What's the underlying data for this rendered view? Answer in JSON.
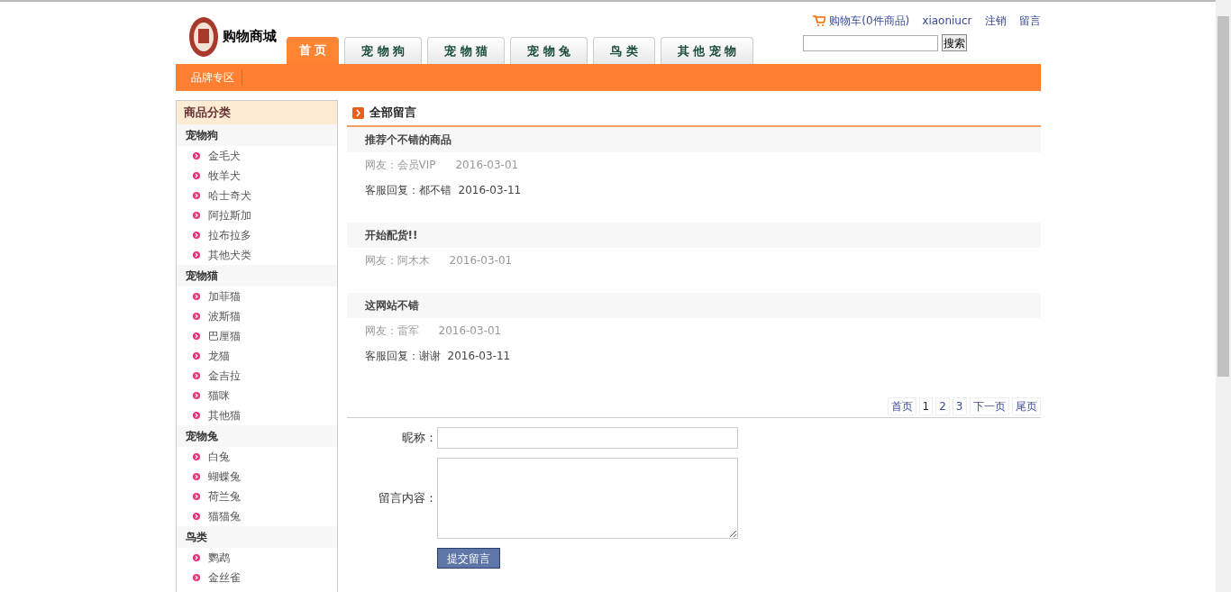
{
  "header": {
    "logo_text": "购物商城",
    "cart": "购物车(0件商品)",
    "links": [
      "xiaoniucr",
      "注销",
      "留言"
    ],
    "search_button": "搜索"
  },
  "nav_tabs": [
    {
      "label": "首 页",
      "selected": true
    },
    {
      "label": "宠 物 狗",
      "selected": false
    },
    {
      "label": "宠 物 猫",
      "selected": false
    },
    {
      "label": "宠 物 兔",
      "selected": false
    },
    {
      "label": "鸟 类",
      "selected": false
    },
    {
      "label": "其 他 宠 物",
      "selected": false
    }
  ],
  "sub_nav": [
    "品牌专区"
  ],
  "sidebar": {
    "title": "商品分类",
    "groups": [
      {
        "name": "宠物狗",
        "items": [
          "金毛犬",
          "牧羊犬",
          "哈士奇犬",
          "阿拉斯加",
          "拉布拉多",
          "其他犬类"
        ]
      },
      {
        "name": "宠物猫",
        "items": [
          "加菲猫",
          "波斯猫",
          "巴厘猫",
          "龙猫",
          "金吉拉",
          "猫咪",
          "其他猫"
        ]
      },
      {
        "name": "宠物兔",
        "items": [
          "白兔",
          "蝴蝶兔",
          "荷兰兔",
          "猫猫兔"
        ]
      },
      {
        "name": "鸟类",
        "items": [
          "鹦鹉",
          "金丝雀"
        ]
      }
    ]
  },
  "messages": {
    "title": "全部留言",
    "items": [
      {
        "subject": "推荐个不错的商品",
        "author": "网友：会员VIP",
        "date": "2016-03-01",
        "reply": "客服回复：都不错",
        "reply_date": "2016-03-11"
      },
      {
        "subject": "开始配货!!",
        "author": "网友：阿木木",
        "date": "2016-03-01"
      },
      {
        "subject": "这网站不错",
        "author": "网友：雷军",
        "date": "2016-03-01",
        "reply": "客服回复：谢谢",
        "reply_date": "2016-03-11"
      }
    ]
  },
  "pagination": [
    {
      "label": "首页",
      "selected": false
    },
    {
      "label": "1",
      "selected": true
    },
    {
      "label": "2",
      "selected": false
    },
    {
      "label": "3",
      "selected": false
    },
    {
      "label": "下一页",
      "selected": false
    },
    {
      "label": "尾页",
      "selected": false
    }
  ],
  "form": {
    "nickname_label": "昵称：",
    "content_label": "留言内容：",
    "submit": "提交留言"
  }
}
